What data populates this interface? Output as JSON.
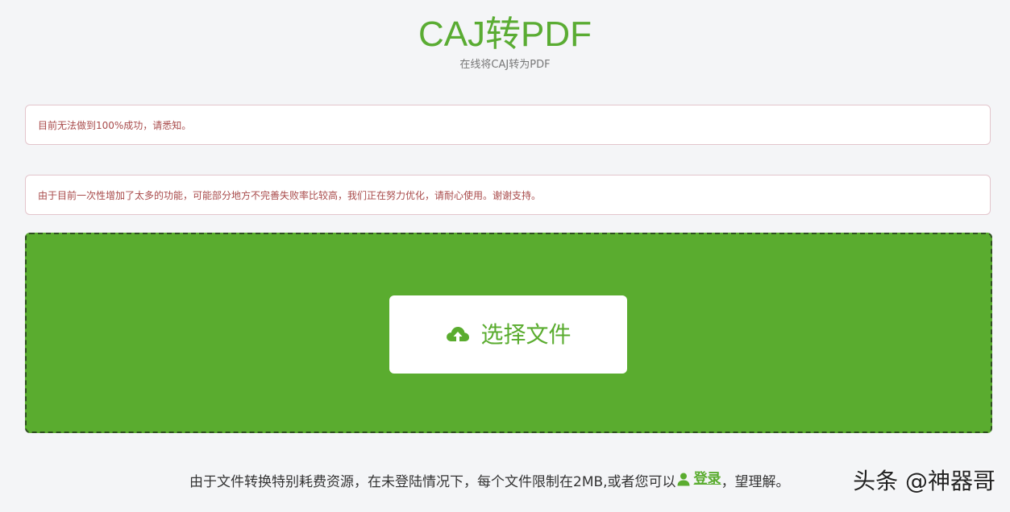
{
  "header": {
    "title": "CAJ转PDF",
    "subtitle": "在线将CAJ转为PDF"
  },
  "alerts": [
    {
      "text": "目前无法做到100%成功，请悉知。"
    },
    {
      "text": "由于目前一次性增加了太多的功能，可能部分地方不完善失败率比较高，我们正在努力优化，请耐心使用。谢谢支持。"
    }
  ],
  "upload": {
    "button_label": "选择文件",
    "icon": "cloud-upload-icon"
  },
  "footer": {
    "note_before": "由于文件转换特别耗费资源，在未登陆情况下，每个文件限制在2MB,或者您可以",
    "login_label": "登录",
    "login_icon": "user-icon",
    "note_after": "，望理解。"
  },
  "watermark": {
    "text": "头条 @神器哥"
  },
  "colors": {
    "brand_green": "#5aac2f",
    "alert_text": "#a84a4a",
    "alert_border": "#e3c5cc",
    "background": "#f4f5f7"
  }
}
